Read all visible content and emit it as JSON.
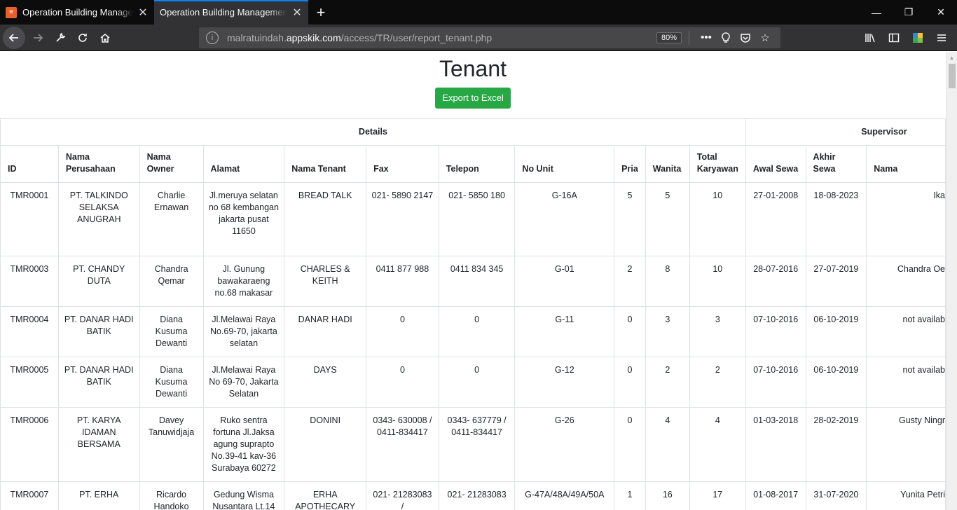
{
  "browser": {
    "tabs": [
      {
        "title": "Operation Building Management System",
        "active": false
      },
      {
        "title": "Operation Building Management System",
        "active": true
      }
    ],
    "url_prefix": "malratuindah.",
    "url_host": "appskik.com",
    "url_path": "/access/TR/user/report_tenant.php",
    "zoom": "80%"
  },
  "page": {
    "title": "Tenant",
    "export_button": "Export to Excel"
  },
  "table": {
    "group_headers": {
      "details": "Details",
      "supervisor": "Supervisor"
    },
    "columns": [
      "ID",
      "Nama Perusahaan",
      "Nama Owner",
      "Alamat",
      "Nama Tenant",
      "Fax",
      "Telepon",
      "No Unit",
      "Pria",
      "Wanita",
      "Total Karyawan",
      "Awal Sewa",
      "Akhir Sewa",
      "Nama"
    ],
    "rows": [
      [
        "TMR0001",
        "PT. TALKINDO SELAKSA ANUGRAH",
        "Charlie Ernawan",
        "Jl.meruya selatan no 68 kembangan jakarta pusat 11650",
        "BREAD TALK",
        "021- 5890 2147",
        "021- 5850 180",
        "G-16A",
        "5",
        "5",
        "10",
        "27-01-2008",
        "18-08-2023",
        "Ika"
      ],
      [
        "TMR0003",
        "PT. CHANDY DUTA",
        "Chandra Qemar",
        "Jl. Gunung bawakaraeng no.68 makasar",
        "CHARLES & KEITH",
        "0411 877 988",
        "0411 834 345",
        "G-01",
        "2",
        "8",
        "10",
        "28-07-2016",
        "27-07-2019",
        "Chandra Oe"
      ],
      [
        "TMR0004",
        "PT. DANAR HADI BATIK",
        "Diana Kusuma Dewanti",
        "Jl.Melawai Raya No.69-70, jakarta selatan",
        "DANAR HADI",
        "0",
        "0",
        "G-11",
        "0",
        "3",
        "3",
        "07-10-2016",
        "06-10-2019",
        "not availab"
      ],
      [
        "TMR0005",
        "PT. DANAR HADI BATIK",
        "Diana Kusuma Dewanti",
        "Jl.Melawai Raya No 69-70, Jakarta Selatan",
        "DAYS",
        "0",
        "0",
        "G-12",
        "0",
        "2",
        "2",
        "07-10-2016",
        "06-10-2019",
        "not availab"
      ],
      [
        "TMR0006",
        "PT. KARYA IDAMAN BERSAMA",
        "Davey Tanuwidjaja",
        "Ruko sentra fortuna Jl.Jaksa agung suprapto No.39-41 kav-36 Surabaya 60272",
        "DONINI",
        "0343- 630008 / 0411-834417",
        "0343- 637779 / 0411-834417",
        "G-26",
        "0",
        "4",
        "4",
        "01-03-2018",
        "28-02-2019",
        "Gusty Ningr"
      ],
      [
        "TMR0007",
        "PT. ERHA",
        "Ricardo Handoko",
        "Gedung Wisma Nusantara Lt.14",
        "ERHA APOTHECARY",
        "021- 21283083 /",
        "021- 21283083",
        "G-47A/48A/49A/50A",
        "1",
        "16",
        "17",
        "01-08-2017",
        "31-07-2020",
        "Yunita Petri"
      ]
    ]
  }
}
